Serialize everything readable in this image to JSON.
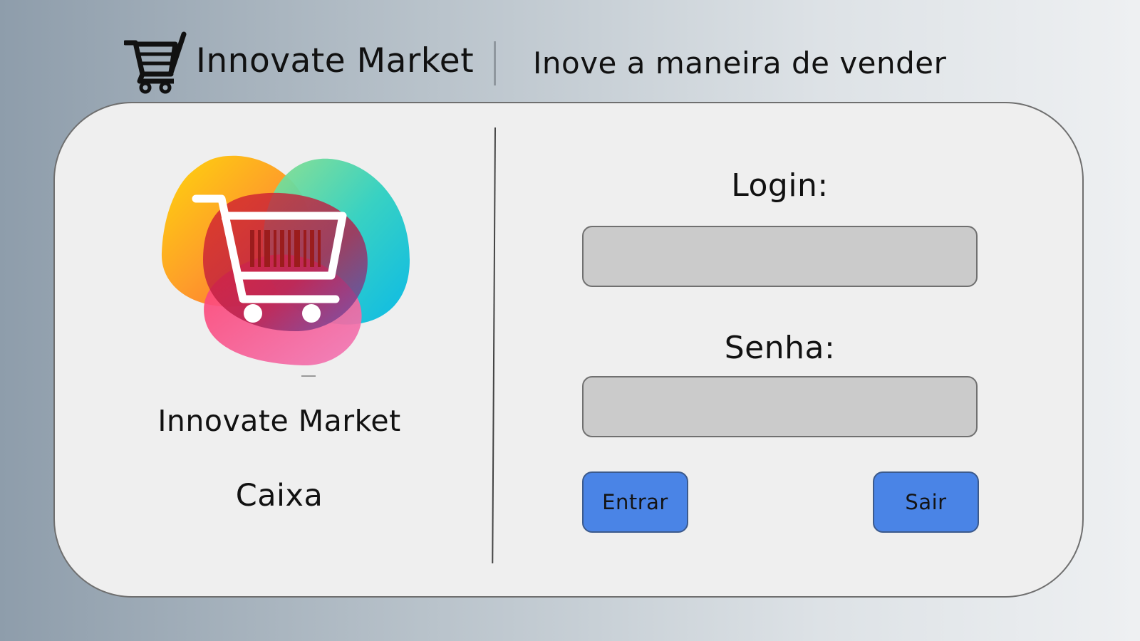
{
  "header": {
    "brand_title": "Innovate Market",
    "tagline": "Inove a maneira de vender"
  },
  "card": {
    "store_name": "Innovate Market",
    "mode_label": "Caixa",
    "login": {
      "label": "Login:",
      "value": "",
      "placeholder": ""
    },
    "senha": {
      "label": "Senha:",
      "value": "",
      "placeholder": ""
    },
    "buttons": {
      "entrar": "Entrar",
      "sair": "Sair"
    }
  },
  "icons": {
    "header": "shopping-cart-icon",
    "logo": "barcode-shopping-cart-logo"
  },
  "colors": {
    "background_left": "#8e9dab",
    "background_right": "#eef0f2",
    "card_background": "#efefef",
    "input_background": "#cbcbcb",
    "button_blue": "#4a84e6",
    "logo_cart_red": "#9b1c1c"
  }
}
